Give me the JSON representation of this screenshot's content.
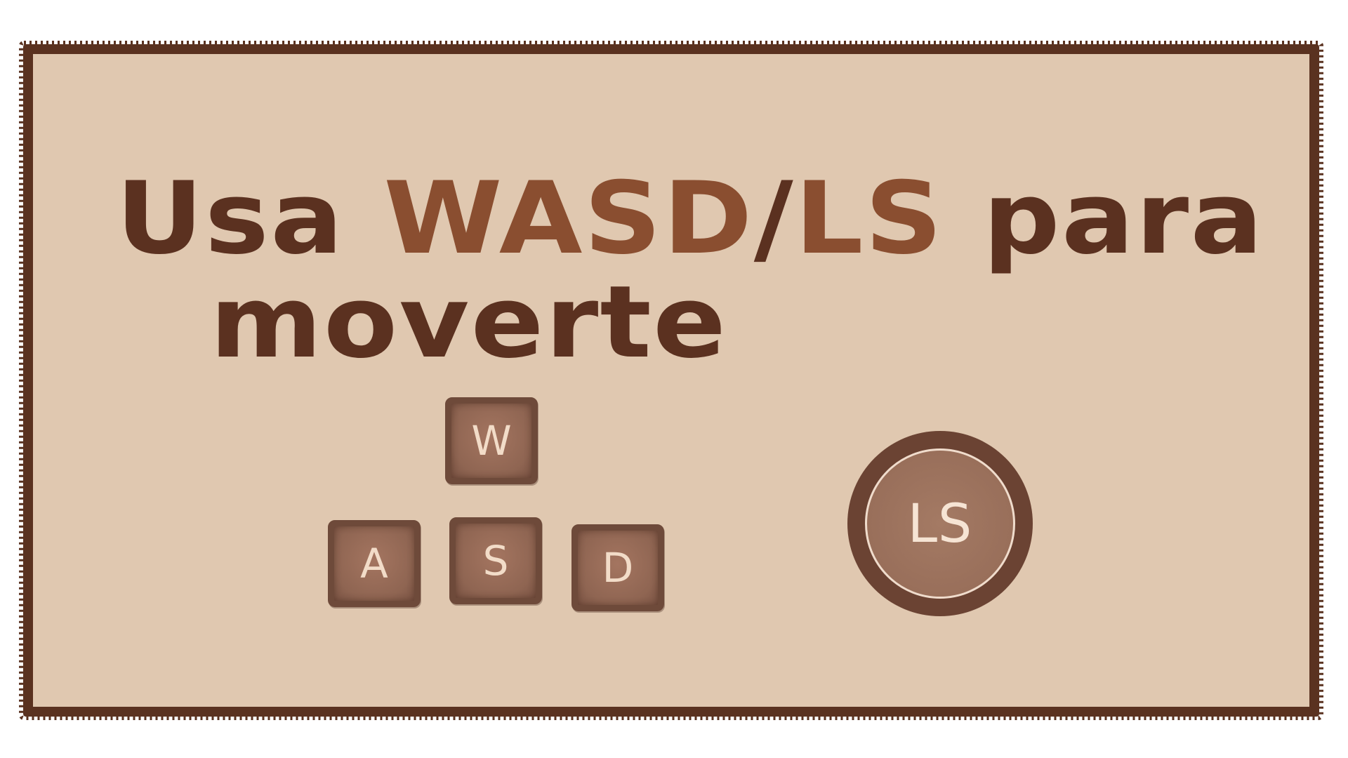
{
  "prompt": {
    "prefix": "Usa ",
    "keys_label": "WASD",
    "separator": "/",
    "stick_label": "LS",
    "suffix": " para",
    "line2": "moverte"
  },
  "keys": {
    "w": "W",
    "a": "A",
    "s": "S",
    "d": "D"
  },
  "stick": {
    "label": "LS"
  },
  "colors": {
    "panel_background": "#e0c8b0",
    "panel_border": "#5a3220",
    "text_dark": "#5b3120",
    "text_accent": "#8a4e30",
    "key_fill": "#8f6552",
    "key_label": "#f2dcc8"
  }
}
